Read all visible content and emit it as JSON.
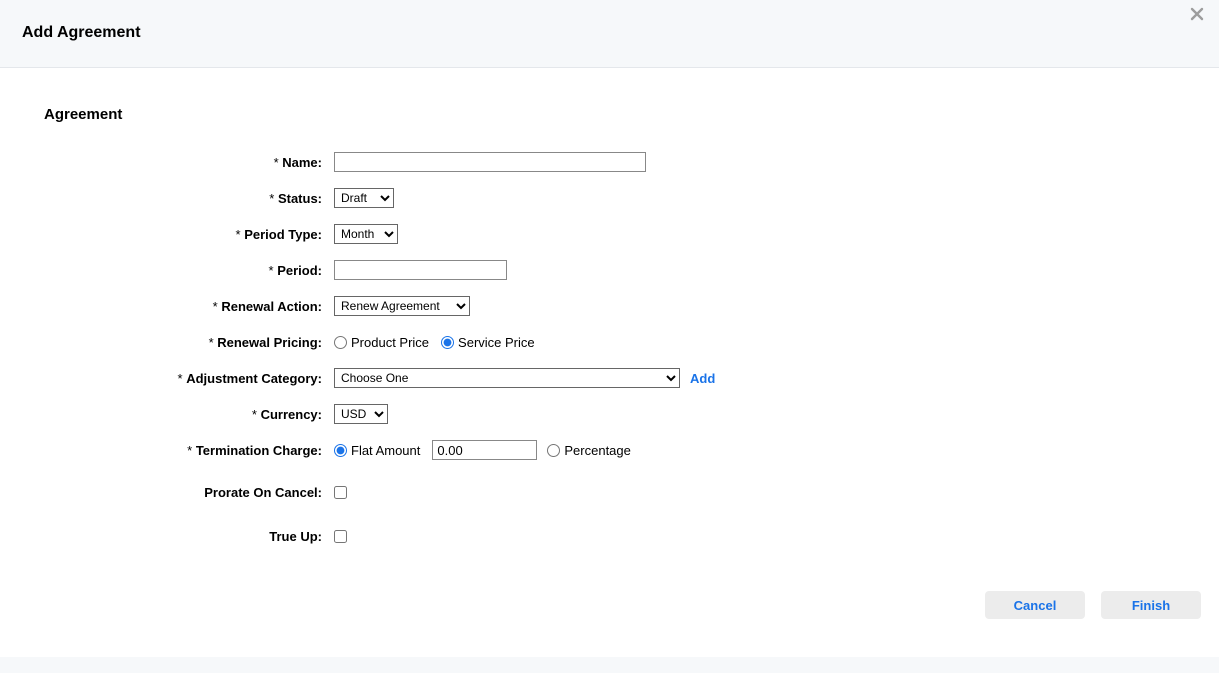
{
  "header": {
    "title": "Add Agreement"
  },
  "section": {
    "title": "Agreement"
  },
  "form": {
    "name": {
      "label": "Name:",
      "required": true,
      "value": ""
    },
    "status": {
      "label": "Status:",
      "required": true,
      "selected": "Draft"
    },
    "period_type": {
      "label": "Period Type:",
      "required": true,
      "selected": "Month"
    },
    "period": {
      "label": "Period:",
      "required": true,
      "value": ""
    },
    "renewal_action": {
      "label": "Renewal Action:",
      "required": true,
      "selected": "Renew Agreement"
    },
    "renewal_pricing": {
      "label": "Renewal Pricing:",
      "required": true,
      "option_product": "Product Price",
      "option_service": "Service Price",
      "selected": "service"
    },
    "adjustment_category": {
      "label": "Adjustment Category:",
      "required": true,
      "selected": "Choose One",
      "add_link": "Add"
    },
    "currency": {
      "label": "Currency:",
      "required": true,
      "selected": "USD"
    },
    "termination_charge": {
      "label": "Termination Charge:",
      "required": true,
      "option_flat": "Flat Amount",
      "option_pct": "Percentage",
      "selected": "flat",
      "flat_amount": "0.00"
    },
    "prorate_on_cancel": {
      "label": "Prorate On Cancel:",
      "checked": false
    },
    "true_up": {
      "label": "True Up:",
      "checked": false
    }
  },
  "footer": {
    "cancel": "Cancel",
    "finish": "Finish"
  }
}
